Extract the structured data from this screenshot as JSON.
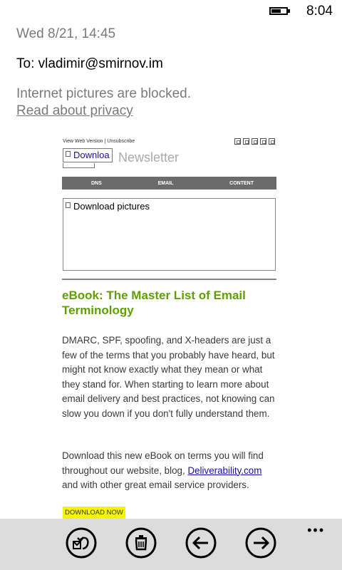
{
  "status": {
    "time": "8:04"
  },
  "email": {
    "date": "Wed 8/21, 14:45",
    "to": "To: vladimir@smirnov.im",
    "blocked_notice": "Internet pictures are blocked.",
    "privacy_link": "Read about privacy"
  },
  "newsletter": {
    "view_web": "View Web Version",
    "separator": " | ",
    "unsubscribe": "Unsubscribe",
    "logo_alt": "Downloa",
    "title": "Newsletter",
    "nav": [
      "DNS",
      "EMAIL",
      "CONTENT"
    ],
    "picture_placeholder": "Download pictures",
    "ebook_title": "eBook: The Master List of Email Terminology",
    "paragraph1": "DMARC, SPF, spoofing, and X-headers are just a few of the terms that you probably have heard, but might not know exactly what they mean or what they stand for. When starting to learn more about email delivery and best practices, not knowing can slow you down if you don't fully understand them.",
    "paragraph2_before": "Download this new eBook on terms you will find throughout our website, blog, ",
    "paragraph2_link": "Deliverability.com",
    "paragraph2_after": " and with other great email service providers.",
    "download_button": "DOWNLOAD NOW"
  },
  "appbar": {
    "more": "•••",
    "buttons": [
      "reply-icon",
      "delete-icon",
      "previous-icon",
      "next-icon"
    ]
  },
  "colors": {
    "appbar_bg": "#dcdcdc",
    "ebook_title": "#5fa000",
    "download_bg": "#f5f500",
    "nav_bg": "#6b6b6b",
    "link": "#1a0dab"
  }
}
